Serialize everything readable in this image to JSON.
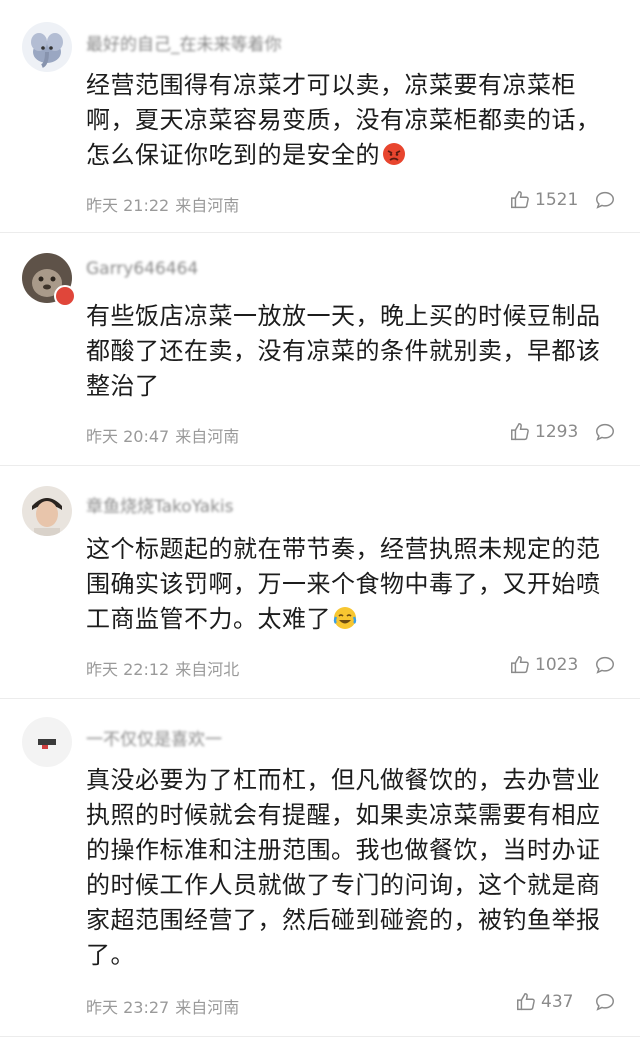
{
  "comments": [
    {
      "username": "最好的自己_在未来等着你",
      "text": "经营范围得有凉菜才可以卖，凉菜要有凉菜柜啊，夏天凉菜容易变质，没有凉菜柜都卖的话，怎么保证你吃到的是安全的",
      "emoji": "angry-face-emoji",
      "time": "昨天 21:22",
      "location": "来自河南",
      "likes": "1521"
    },
    {
      "username": "Garry646464",
      "text": "有些饭店凉菜一放放一天，晚上买的时候豆制品都酸了还在卖，没有凉菜的条件就别卖，早都该整治了",
      "time": "昨天 20:47",
      "location": "来自河南",
      "likes": "1293"
    },
    {
      "username": "章鱼烧烧TakoYakis",
      "text": "这个标题起的就在带节奏，经营执照未规定的范围确实该罚啊，万一来个食物中毒了，又开始喷工商监管不力。太难了",
      "emoji": "laughing-crying-emoji",
      "time": "昨天 22:12",
      "location": "来自河北",
      "likes": "1023"
    },
    {
      "username": "一不仅仅是喜欢一",
      "text": "真没必要为了杠而杠，但凡做餐饮的，去办营业执照的时候就会有提醒，如果卖凉菜需要有相应的操作标准和注册范围。我也做餐饮，当时办证的时候工作人员就做了专门的问询，这个就是商家超范围经营了，然后碰到碰瓷的，被钓鱼举报了。",
      "time": "昨天 23:27",
      "location": "来自河南",
      "likes": "437"
    }
  ],
  "icons": {
    "like": "thumbs-up-icon",
    "reply": "comment-bubble-icon"
  },
  "colors": {
    "meta_text": "#9a9a9a",
    "body_text": "#1c1c1c",
    "divider": "#ececec"
  }
}
